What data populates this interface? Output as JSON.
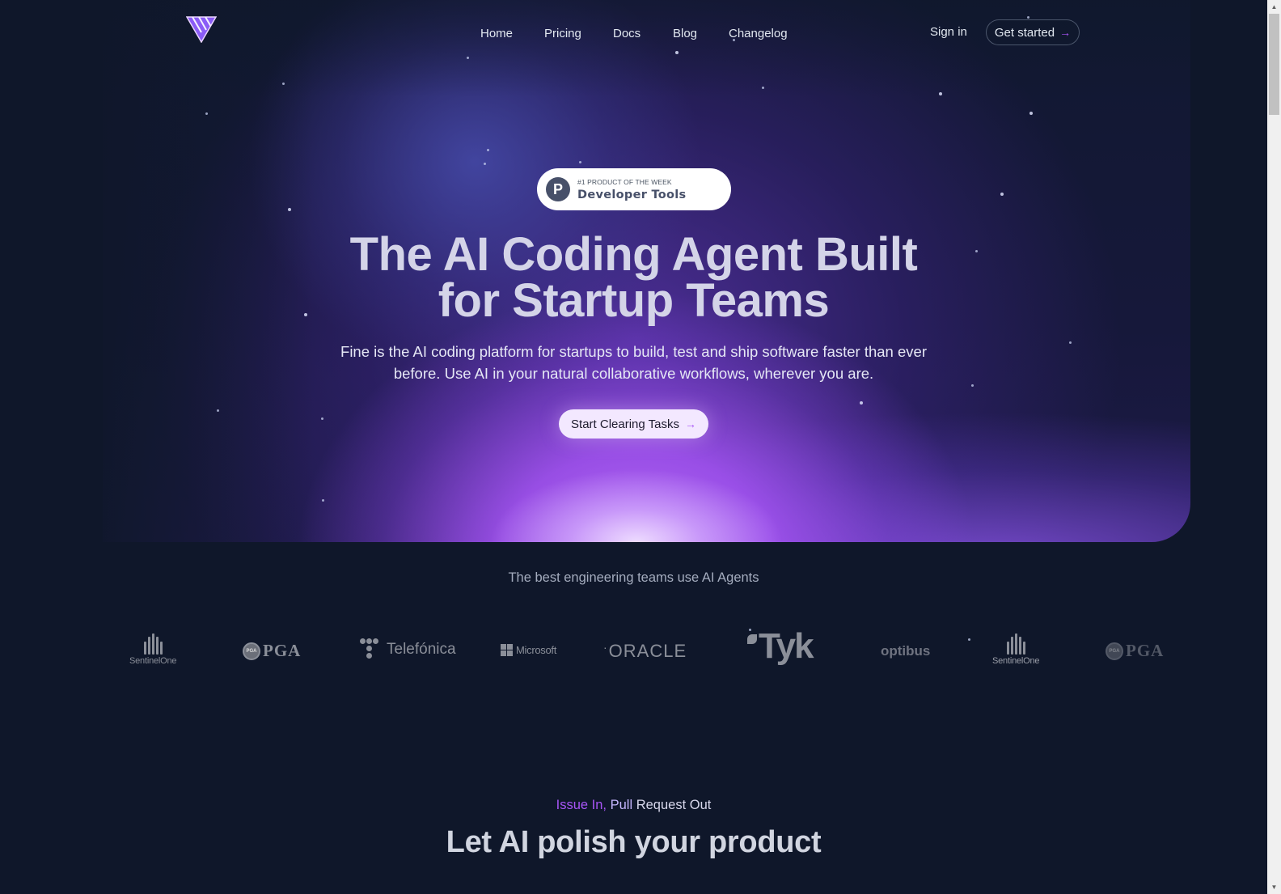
{
  "nav": {
    "logo": "fine-logo",
    "links": [
      {
        "label": "Home"
      },
      {
        "label": "Pricing"
      },
      {
        "label": "Docs"
      },
      {
        "label": "Blog"
      },
      {
        "label": "Changelog"
      }
    ],
    "sign_in": "Sign in",
    "get_started": "Get started",
    "get_started_icon": "arrow-right-icon"
  },
  "badge": {
    "icon_letter": "P",
    "kicker": "#1 PRODUCT OF THE WEEK",
    "title": "Developer Tools"
  },
  "hero": {
    "headline_line1": "The AI Coding Agent Built",
    "headline_line2": "for Startup Teams",
    "subtitle_line1": "Fine is the AI coding platform for startups to build, test and ship software faster than ever",
    "subtitle_line2": "before. Use AI in your natural collaborative workflows, wherever you are.",
    "cta_label": "Start Clearing Tasks",
    "cta_icon": "arrow-right-icon",
    "accent_color": "#a855f7"
  },
  "logos": {
    "caption": "The best engineering teams use AI Agents",
    "items": [
      {
        "name": "SentinelOne"
      },
      {
        "name": "PGA"
      },
      {
        "name": "Telefónica"
      },
      {
        "name": "Microsoft"
      },
      {
        "name": "ORACLE"
      },
      {
        "name": "Tyk"
      },
      {
        "name": "optibus"
      },
      {
        "name": "SentinelOne"
      },
      {
        "name": "PGA"
      }
    ]
  },
  "section": {
    "eyebrow_part1": "Issue In,",
    "eyebrow_part2": "Pull",
    "eyebrow_part3": "Request Out",
    "title": "Let AI polish your product"
  }
}
